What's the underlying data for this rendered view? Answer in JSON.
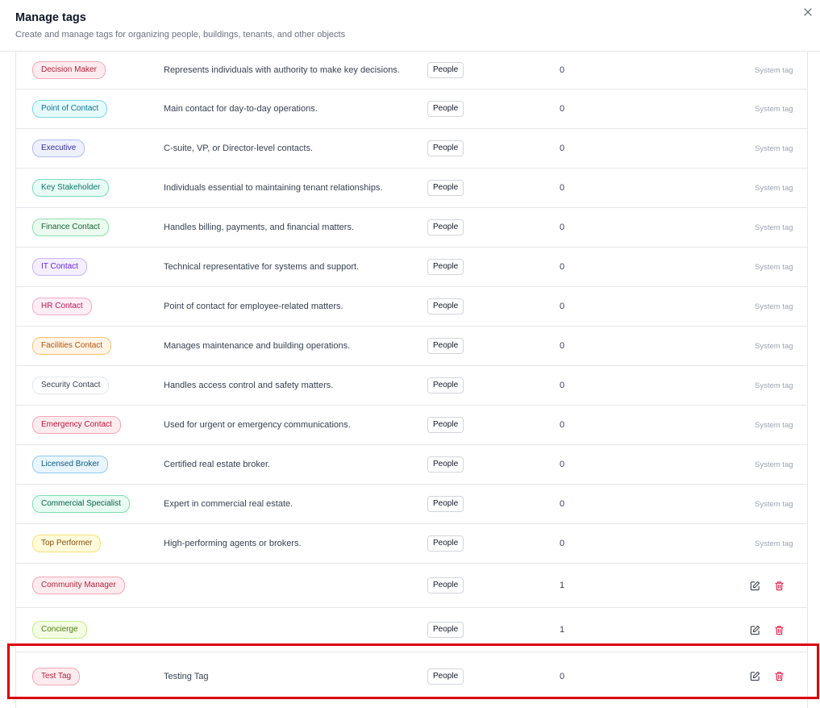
{
  "header": {
    "title": "Manage tags",
    "subtitle": "Create and manage tags for organizing people, buildings, tenants, and other objects"
  },
  "colors": {
    "red": {
      "bg": "#fdecef",
      "border": "#f4a7b5",
      "text": "#b4233c"
    },
    "cyan": {
      "bg": "#e6fbfd",
      "border": "#7fd7e3",
      "text": "#0e7490"
    },
    "indigo": {
      "bg": "#eef0fd",
      "border": "#b4bcf2",
      "text": "#3730a3"
    },
    "teal": {
      "bg": "#e8fbf5",
      "border": "#7fdcc1",
      "text": "#0f766e"
    },
    "green": {
      "bg": "#ebfbf0",
      "border": "#8fe0ac",
      "text": "#166534"
    },
    "purple": {
      "bg": "#f4effe",
      "border": "#c9b5f5",
      "text": "#6d28d9"
    },
    "pink": {
      "bg": "#fdedf4",
      "border": "#f5a9c8",
      "text": "#be185d"
    },
    "orange": {
      "bg": "#fff4e5",
      "border": "#f6c27a",
      "text": "#b45309"
    },
    "gray": {
      "bg": "#ffffff",
      "border": "#e5e7eb",
      "text": "#374151"
    },
    "rose": {
      "bg": "#fdecef",
      "border": "#f4a7b5",
      "text": "#be123c"
    },
    "sky": {
      "bg": "#e9f5fd",
      "border": "#8cc9ee",
      "text": "#075985"
    },
    "emerald": {
      "bg": "#e8fbf2",
      "border": "#7fdcb0",
      "text": "#065f46"
    },
    "yellow": {
      "bg": "#fffbdb",
      "border": "#f3e17a",
      "text": "#854d0e"
    },
    "lime": {
      "bg": "#f4fde4",
      "border": "#c3ea8a",
      "text": "#4d7c0f"
    }
  },
  "rows": [
    {
      "tag": "Decision Maker",
      "color": "red",
      "description": "Represents individuals with authority to make key decisions.",
      "type": "People",
      "count": "0",
      "system": "System tag"
    },
    {
      "tag": "Point of Contact",
      "color": "cyan",
      "description": "Main contact for day-to-day operations.",
      "type": "People",
      "count": "0",
      "system": "System tag"
    },
    {
      "tag": "Executive",
      "color": "indigo",
      "description": "C-suite, VP, or Director-level contacts.",
      "type": "People",
      "count": "0",
      "system": "System tag"
    },
    {
      "tag": "Key Stakeholder",
      "color": "teal",
      "description": "Individuals essential to maintaining tenant relationships.",
      "type": "People",
      "count": "0",
      "system": "System tag"
    },
    {
      "tag": "Finance Contact",
      "color": "green",
      "description": "Handles billing, payments, and financial matters.",
      "type": "People",
      "count": "0",
      "system": "System tag"
    },
    {
      "tag": "IT Contact",
      "color": "purple",
      "description": "Technical representative for systems and support.",
      "type": "People",
      "count": "0",
      "system": "System tag"
    },
    {
      "tag": "HR Contact",
      "color": "pink",
      "description": "Point of contact for employee-related matters.",
      "type": "People",
      "count": "0",
      "system": "System tag"
    },
    {
      "tag": "Facilities Contact",
      "color": "orange",
      "description": "Manages maintenance and building operations.",
      "type": "People",
      "count": "0",
      "system": "System tag"
    },
    {
      "tag": "Security Contact",
      "color": "gray",
      "description": "Handles access control and safety matters.",
      "type": "People",
      "count": "0",
      "system": "System tag"
    },
    {
      "tag": "Emergency Contact",
      "color": "rose",
      "description": "Used for urgent or emergency communications.",
      "type": "People",
      "count": "0",
      "system": "System tag"
    },
    {
      "tag": "Licensed Broker",
      "color": "sky",
      "description": "Certified real estate broker.",
      "type": "People",
      "count": "0",
      "system": "System tag"
    },
    {
      "tag": "Commercial Specialist",
      "color": "emerald",
      "description": "Expert in commercial real estate.",
      "type": "People",
      "count": "0",
      "system": "System tag"
    },
    {
      "tag": "Top Performer",
      "color": "yellow",
      "description": "High-performing agents or brokers.",
      "type": "People",
      "count": "0",
      "system": "System tag"
    },
    {
      "tag": "Community Manager",
      "color": "red",
      "description": "",
      "type": "People",
      "count": "1",
      "system": ""
    },
    {
      "tag": "Concierge",
      "color": "lime",
      "description": "",
      "type": "People",
      "count": "1",
      "system": ""
    },
    {
      "tag": "Test Tag",
      "color": "red",
      "description": "Testing Tag",
      "type": "People",
      "count": "0",
      "system": ""
    }
  ]
}
